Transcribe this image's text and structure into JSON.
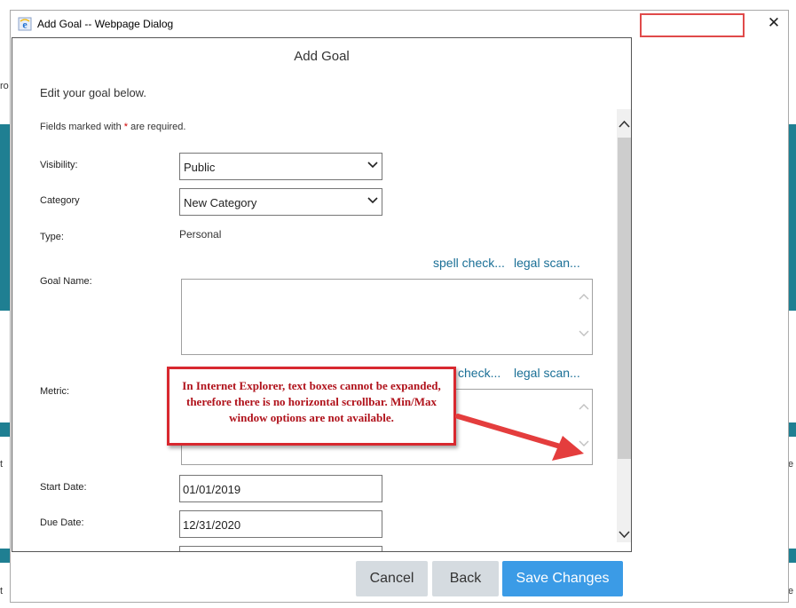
{
  "window": {
    "title": "Add Goal -- Webpage Dialog",
    "close_glyph": "✕"
  },
  "background": {
    "left_fragments": [
      "ro",
      "t",
      "t"
    ],
    "right_fragments": [
      "te",
      "te"
    ],
    "accent_color": "#1f7f92"
  },
  "dialog": {
    "heading": "Add Goal",
    "intro": "Edit your goal below.",
    "required_note_before": "Fields marked with ",
    "required_star": "*",
    "required_note_after": " are required."
  },
  "form": {
    "visibility_label": "Visibility:",
    "visibility_value": "Public",
    "category_label": "Category",
    "category_value": "New Category",
    "type_label": "Type:",
    "type_value": "Personal",
    "goal_name_label": "Goal Name:",
    "metric_label": "Metric:",
    "start_date_label": "Start Date:",
    "start_date_value": "01/01/2019",
    "due_date_label": "Due Date:",
    "due_date_value": "12/31/2020"
  },
  "links": {
    "spell_check": "spell check...",
    "legal_scan": "legal scan...",
    "spell_check_partial": "check..."
  },
  "annotation": {
    "text": "In Internet Explorer, text boxes cannot be expanded, therefore there is no horizontal scrollbar. Min/Max window options are not available.",
    "color": "#d8282f"
  },
  "buttons": {
    "cancel": "Cancel",
    "back": "Back",
    "save": "Save Changes"
  },
  "colors": {
    "primary_button": "#3b9be6",
    "secondary_button": "#d5dbe0",
    "link": "#1a6f96"
  }
}
